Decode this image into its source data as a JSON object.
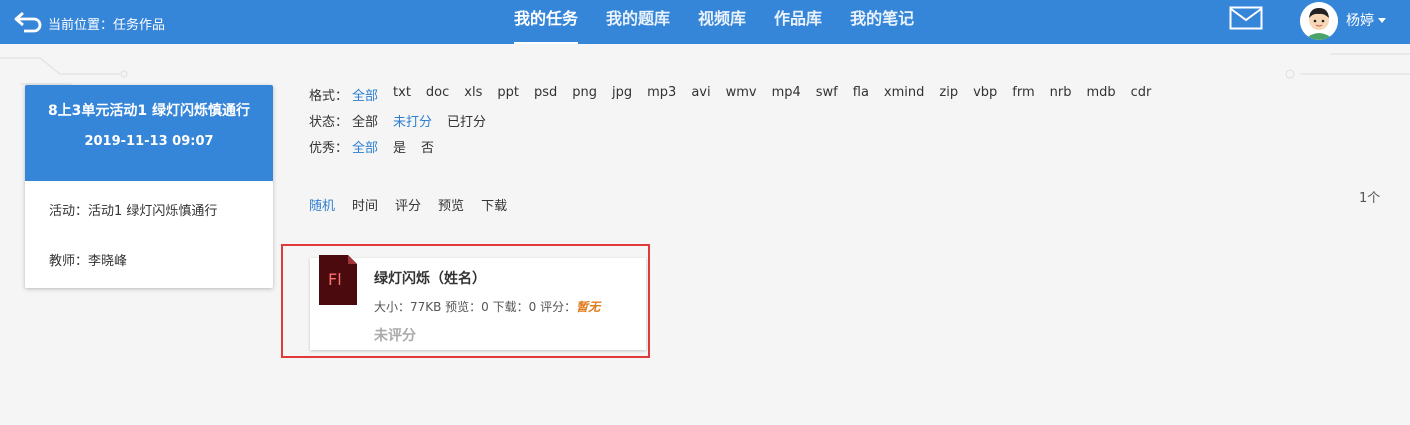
{
  "header": {
    "breadcrumb": "当前位置：任务作品",
    "nav": [
      "我的任务",
      "我的题库",
      "视频库",
      "作品库",
      "我的笔记"
    ],
    "active_nav": 0,
    "user": "杨婷",
    "accent": "#3585d9"
  },
  "card": {
    "title": "8上3单元活动1 绿灯闪烁慎通行",
    "date": "2019-11-13 09:07",
    "activity": "活动：活动1 绿灯闪烁慎通行",
    "teacher": "教师：李晓峰"
  },
  "filters": {
    "format": {
      "label": "格式：",
      "options": [
        "全部",
        "txt",
        "doc",
        "xls",
        "ppt",
        "psd",
        "png",
        "jpg",
        "mp3",
        "avi",
        "wmv",
        "mp4",
        "swf",
        "fla",
        "xmind",
        "zip",
        "vbp",
        "frm",
        "nrb",
        "mdb",
        "cdr"
      ],
      "selected": 0
    },
    "status": {
      "label": "状态：",
      "options": [
        "全部",
        "未打分",
        "已打分"
      ],
      "selected": 1
    },
    "excellent": {
      "label": "优秀：",
      "options": [
        "全部",
        "是",
        "否"
      ],
      "selected": 0
    }
  },
  "sorts": {
    "options": [
      "随机",
      "时间",
      "评分",
      "预览",
      "下载"
    ],
    "selected": 0
  },
  "count": "1个",
  "work": {
    "icon": "fl-file-icon",
    "icon_text": "Fl",
    "title": "绿灯闪烁（姓名）",
    "meta": "大小：77KB 预览：0 下载：0 评分：",
    "score": "暂无",
    "status": "未评分"
  }
}
